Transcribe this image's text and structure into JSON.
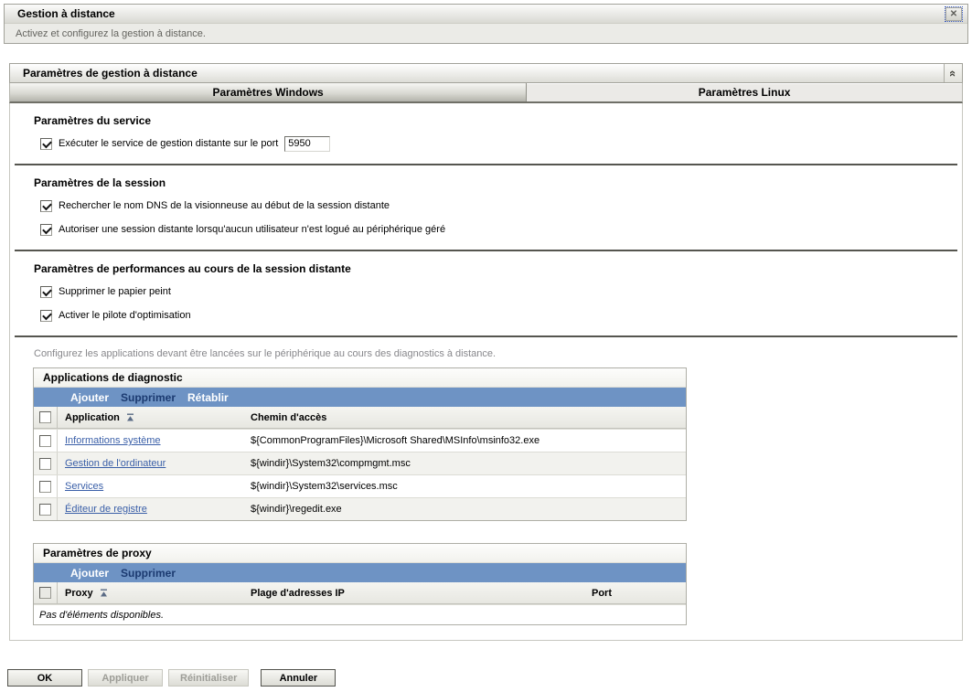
{
  "header": {
    "title": "Gestion à distance",
    "subtitle": "Activez et configurez la gestion à distance."
  },
  "panel": {
    "title": "Paramètres de gestion à distance",
    "tabs": [
      {
        "label": "Paramètres Windows",
        "active": true
      },
      {
        "label": "Paramètres Linux",
        "active": false
      }
    ]
  },
  "sections": {
    "service": {
      "heading": "Paramètres du service",
      "run_service_label": "Exécuter le service de gestion distante sur le port",
      "port_value": "5950",
      "checked": true
    },
    "session": {
      "heading": "Paramètres de la session",
      "options": [
        {
          "label": "Rechercher le nom DNS de la visionneuse au début de la session distante",
          "checked": true
        },
        {
          "label": "Autoriser une session distante lorsqu'aucun utilisateur n'est logué au périphérique géré",
          "checked": true
        }
      ]
    },
    "performance": {
      "heading": "Paramètres de performances au cours de la session distante",
      "options": [
        {
          "label": "Supprimer le papier peint",
          "checked": true
        },
        {
          "label": "Activer le pilote d'optimisation",
          "checked": true
        }
      ]
    },
    "diagnostics_note": "Configurez les applications devant être lancées sur le périphérique au cours des diagnostics à distance."
  },
  "diagnostic_table": {
    "title": "Applications de diagnostic",
    "toolbar": [
      {
        "label": "Ajouter",
        "enabled": true
      },
      {
        "label": "Supprimer",
        "enabled": false
      },
      {
        "label": "Rétablir",
        "enabled": true
      }
    ],
    "columns": {
      "application": "Application",
      "path": "Chemin d'accès"
    },
    "rows": [
      {
        "application": "Informations système",
        "path": "${CommonProgramFiles}\\Microsoft Shared\\MSInfo\\msinfo32.exe"
      },
      {
        "application": "Gestion de l'ordinateur",
        "path": "${windir}\\System32\\compmgmt.msc"
      },
      {
        "application": "Services",
        "path": "${windir}\\System32\\services.msc"
      },
      {
        "application": "Éditeur de registre",
        "path": "${windir}\\regedit.exe"
      }
    ]
  },
  "proxy_table": {
    "title": "Paramètres de proxy",
    "toolbar": [
      {
        "label": "Ajouter",
        "enabled": true
      },
      {
        "label": "Supprimer",
        "enabled": false
      }
    ],
    "columns": {
      "proxy": "Proxy",
      "ip_range": "Plage d'adresses IP",
      "port": "Port"
    },
    "empty_text": "Pas d'éléments disponibles."
  },
  "footer": {
    "buttons": [
      {
        "label": "OK",
        "enabled": true
      },
      {
        "label": "Appliquer",
        "enabled": false
      },
      {
        "label": "Réinitialiser",
        "enabled": false
      },
      {
        "label": "Annuler",
        "enabled": true
      }
    ]
  },
  "colors": {
    "toolbar_blue": "#6e93c4",
    "link_blue": "#3a5fa8",
    "disabled_link_navy": "#1b3a70",
    "tab_border_dark": "#6f6f67"
  }
}
